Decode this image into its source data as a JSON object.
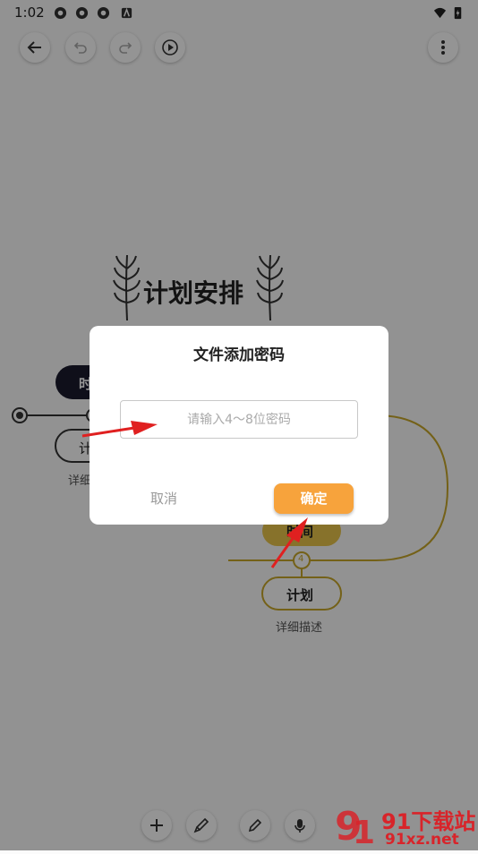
{
  "status_bar": {
    "time": "1:02"
  },
  "toolbar": {
    "icons": [
      "back-arrow-icon",
      "undo-icon",
      "redo-icon",
      "play-icon",
      "more-vert-icon"
    ]
  },
  "mindmap": {
    "title": "计划安排",
    "nodes": [
      {
        "label": "时间"
      },
      {
        "label": "计划"
      },
      {
        "label": "详细描述"
      },
      {
        "label": "时间"
      },
      {
        "label": "4"
      },
      {
        "label": "计划"
      },
      {
        "label": "详细描述"
      }
    ],
    "colors": {
      "dark": "#1a1a2e",
      "yellow": "#e8c44a",
      "line": "#c9a82a"
    }
  },
  "dialog": {
    "title": "文件添加密码",
    "input_placeholder": "请输入4～8位密码",
    "input_value": "",
    "cancel_label": "取消",
    "confirm_label": "确定",
    "accent": "#f7a33c"
  },
  "bottom_toolbar": {
    "icons": [
      "add-icon",
      "brush-icon",
      "pen-icon",
      "mic-icon"
    ]
  },
  "watermark": {
    "brand": "91下载站",
    "url": "91xz.net"
  }
}
